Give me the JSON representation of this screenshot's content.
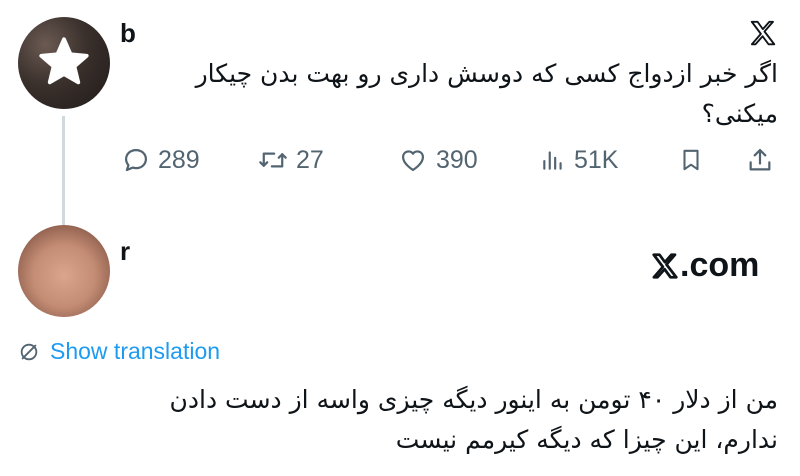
{
  "tweet_main": {
    "username": "b",
    "text_line1": "اگر خبر ازدواج کسی که دوسش داری رو بهت بدن چیکار",
    "text_line2": "میکنی؟",
    "stats": {
      "replies": "289",
      "retweets": "27",
      "likes": "390",
      "views": "51K"
    }
  },
  "reply": {
    "username": "r",
    "text_line1": "من از دلار ۴۰ تومن به اینور دیگه چیزی واسه از دست دادن",
    "text_line2": "ندارم، این چیزا که دیگه کیرمم نیست",
    "translate_label": "Show translation"
  },
  "watermark": {
    "suffix": ".com"
  },
  "icons": [
    "x-logo-icon",
    "reply-icon",
    "retweet-icon",
    "like-icon",
    "views-icon",
    "bookmark-icon",
    "share-icon",
    "translate-icon",
    "star-icon"
  ],
  "colors": {
    "text": "#0f1419",
    "muted": "#536471",
    "link": "#1d9bf0",
    "thread_line": "#cfd9de"
  }
}
